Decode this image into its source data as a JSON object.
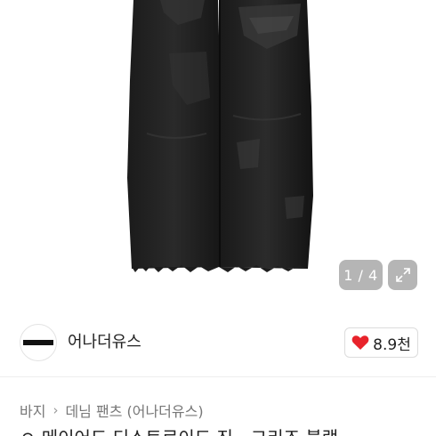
{
  "gallery": {
    "page_counter": "1 / 4",
    "expand_icon": "expand-icon"
  },
  "seller": {
    "name": "어나더유스",
    "avatar_icon": "brand-logo"
  },
  "like": {
    "icon": "heart-icon",
    "count": "8.9천",
    "heart_color": "#e8232b"
  },
  "breadcrumb": {
    "category": "바지",
    "subcategory": "데님 팬츠 (어나더유스)"
  },
  "title": {
    "text": "ㅇ 메이어드 디스트로이드 진 - 그리즈 블랙"
  }
}
